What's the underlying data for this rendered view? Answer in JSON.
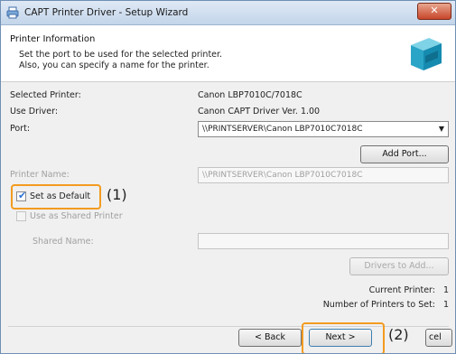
{
  "window": {
    "title": "CAPT Printer Driver - Setup Wizard",
    "close_label": "✕"
  },
  "header": {
    "title": "Printer Information",
    "desc_line1": "Set the port to be used for the selected printer.",
    "desc_line2": "Also, you can specify a name for the printer."
  },
  "info": {
    "selected_printer_label": "Selected Printer:",
    "selected_printer_value": "Canon LBP7010C/7018C",
    "use_driver_label": "Use Driver:",
    "use_driver_value": "Canon CAPT Driver Ver. 1.00",
    "port_label": "Port:",
    "port_value": "\\\\PRINTSERVER\\Canon LBP7010C7018C"
  },
  "buttons": {
    "add_port": "Add Port...",
    "drivers_to_add": "Drivers to Add...",
    "back": "< Back",
    "next": "Next >",
    "cancel": "Cancel",
    "cancel_visible": "cel"
  },
  "printer_name": {
    "label": "Printer Name:",
    "value": "\\\\PRINTSERVER\\Canon LBP7010C7018C"
  },
  "options": {
    "set_default": "Set as Default",
    "set_default_checked": true,
    "use_shared": "Use as Shared Printer",
    "use_shared_checked": false,
    "shared_name_label": "Shared Name:"
  },
  "counts": {
    "current_printer_label": "Current Printer:",
    "current_printer_value": "1",
    "printers_to_set_label": "Number of Printers to Set:",
    "printers_to_set_value": "1"
  },
  "callouts": {
    "one": "(1)",
    "two": "(2)"
  },
  "colors": {
    "highlight": "#f39b1f",
    "close_button": "#c8462a"
  }
}
